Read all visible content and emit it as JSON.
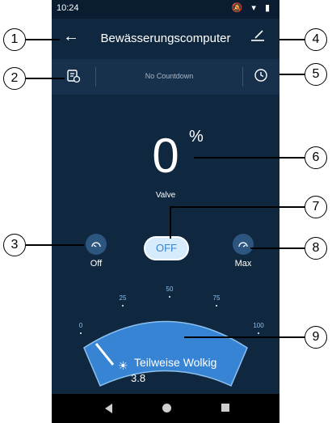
{
  "status_bar": {
    "time": "10:24",
    "icons_text": "🔕 ▾ ▮"
  },
  "header": {
    "title": "Bewässerungscomputer"
  },
  "toolbar": {
    "countdown_text": "No Countdown"
  },
  "valve": {
    "percent_value": "0",
    "percent_sign": "%",
    "label": "Valve",
    "toggle_label": "OFF",
    "off_label": "Off",
    "max_label": "Max"
  },
  "gauge": {
    "ticks": [
      "0",
      "25",
      "50",
      "75",
      "100"
    ],
    "value": 0,
    "max": 100,
    "color": "#3784d4"
  },
  "weather": {
    "text": "Teilweise Wolkig",
    "value": "3.8"
  },
  "callouts": [
    "1",
    "2",
    "3",
    "4",
    "5",
    "6",
    "7",
    "8",
    "9"
  ],
  "colors": {
    "background": "#10283f",
    "accent": "#3784d4",
    "toggle_bg": "#d6ebfb"
  }
}
